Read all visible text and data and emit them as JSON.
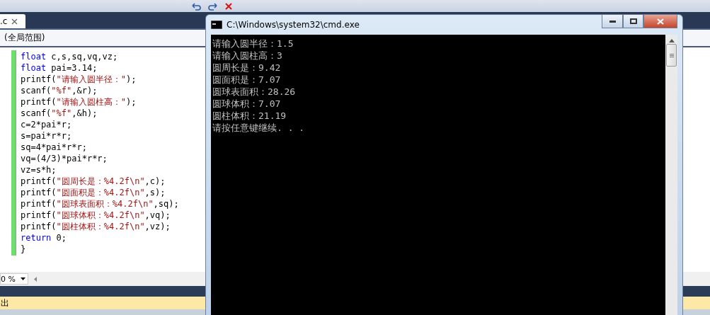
{
  "editor": {
    "tab": {
      "label": ".c",
      "selected": true
    },
    "scope": "(全局范围)",
    "lines": [
      [
        {
          "kind": "keyword",
          "text": "float"
        },
        {
          "kind": "plain",
          "text": " c,s,sq,vq,vz;"
        }
      ],
      [
        {
          "kind": "keyword",
          "text": "float"
        },
        {
          "kind": "plain",
          "text": " pai=3.14;"
        }
      ],
      [
        {
          "kind": "plain",
          "text": "printf("
        },
        {
          "kind": "string",
          "text": "\"请输入圆半径：\""
        },
        {
          "kind": "plain",
          "text": ");"
        }
      ],
      [
        {
          "kind": "plain",
          "text": "scanf("
        },
        {
          "kind": "string",
          "text": "\"%f\""
        },
        {
          "kind": "plain",
          "text": ",&r);"
        }
      ],
      [
        {
          "kind": "plain",
          "text": "printf("
        },
        {
          "kind": "string",
          "text": "\"请输入圆柱高：\""
        },
        {
          "kind": "plain",
          "text": ");"
        }
      ],
      [
        {
          "kind": "plain",
          "text": "scanf("
        },
        {
          "kind": "string",
          "text": "\"%f\""
        },
        {
          "kind": "plain",
          "text": ",&h);"
        }
      ],
      [
        {
          "kind": "plain",
          "text": "c=2*pai*r;"
        }
      ],
      [
        {
          "kind": "plain",
          "text": "s=pai*r*r;"
        }
      ],
      [
        {
          "kind": "plain",
          "text": "sq=4*pai*r*r;"
        }
      ],
      [
        {
          "kind": "plain",
          "text": "vq=(4/3)*pai*r*r;"
        }
      ],
      [
        {
          "kind": "plain",
          "text": "vz=s*h;"
        }
      ],
      [
        {
          "kind": "plain",
          "text": "printf("
        },
        {
          "kind": "string",
          "text": "\"圆周长是：%4.2f\\n\""
        },
        {
          "kind": "plain",
          "text": ",c);"
        }
      ],
      [
        {
          "kind": "plain",
          "text": "printf("
        },
        {
          "kind": "string",
          "text": "\"圆面积是：%4.2f\\n\""
        },
        {
          "kind": "plain",
          "text": ",s);"
        }
      ],
      [
        {
          "kind": "plain",
          "text": "printf("
        },
        {
          "kind": "string",
          "text": "\"圆球表面积：%4.2f\\n\""
        },
        {
          "kind": "plain",
          "text": ",sq);"
        }
      ],
      [
        {
          "kind": "plain",
          "text": "printf("
        },
        {
          "kind": "string",
          "text": "\"圆球体积：%4.2f\\n\""
        },
        {
          "kind": "plain",
          "text": ",vq);"
        }
      ],
      [
        {
          "kind": "plain",
          "text": "printf("
        },
        {
          "kind": "string",
          "text": "\"圆柱体积：%4.2f\\n\""
        },
        {
          "kind": "plain",
          "text": ",vz);"
        }
      ],
      [
        {
          "kind": "keyword",
          "text": "return"
        },
        {
          "kind": "plain",
          "text": " 0;"
        }
      ],
      [
        {
          "kind": "plain",
          "text": "}"
        }
      ]
    ],
    "zoom": "0 %"
  },
  "output_panel": {
    "title": "出"
  },
  "console": {
    "title": "C:\\Windows\\system32\\cmd.exe",
    "lines": [
      "请输入圆半径：1.5",
      "请输入圆柱高：3",
      "圆周长是：9.42",
      "圆面积是：7.07",
      "圆球表面积：28.26",
      "圆球体积：7.07",
      "圆柱体积：21.19",
      "请按任意键继续. . ."
    ]
  }
}
